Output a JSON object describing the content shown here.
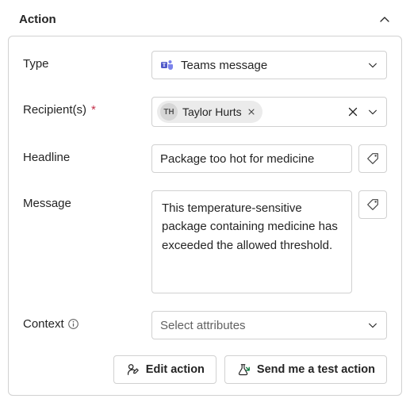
{
  "panel": {
    "title": "Action"
  },
  "fields": {
    "type": {
      "label": "Type",
      "value": "Teams message"
    },
    "recipients": {
      "label": "Recipient(s)",
      "required_mark": "*",
      "chip": {
        "initials": "TH",
        "name": "Taylor Hurts"
      }
    },
    "headline": {
      "label": "Headline",
      "value": "Package too hot for medicine"
    },
    "message": {
      "label": "Message",
      "value": "This temperature-sensitive package containing medicine has exceeded the allowed threshold."
    },
    "context": {
      "label": "Context",
      "placeholder": "Select attributes"
    }
  },
  "buttons": {
    "edit": "Edit action",
    "test": "Send me a test action"
  }
}
